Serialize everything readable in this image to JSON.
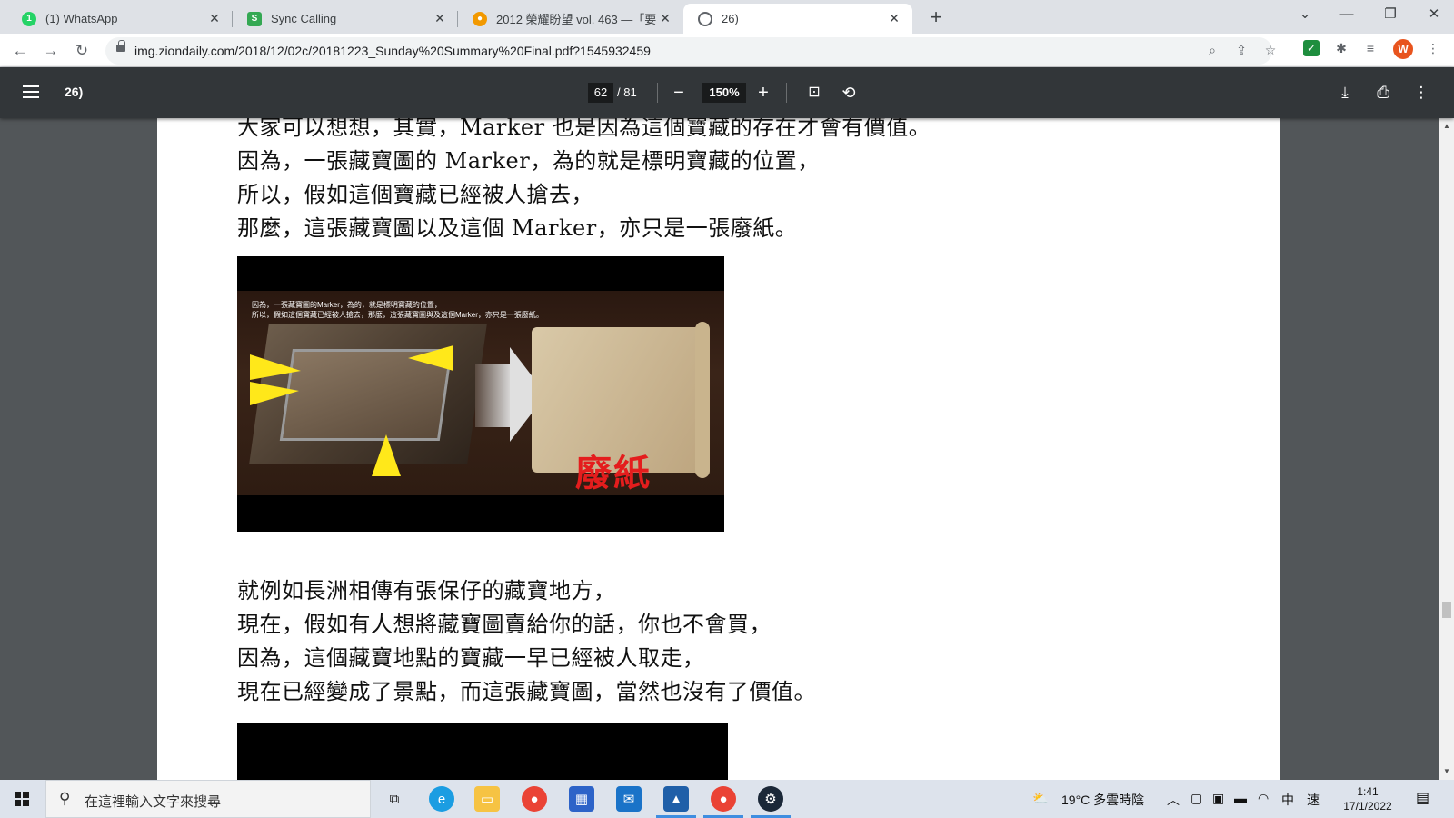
{
  "tabs": [
    {
      "title": "(1) WhatsApp",
      "favicon": "whatsapp-icon",
      "color": "#25d366"
    },
    {
      "title": "Sync Calling",
      "favicon": "sync-calling-icon",
      "color": "#34a853"
    },
    {
      "title": "2012 榮耀盼望 vol. 463 —「要",
      "favicon": "cookie-icon",
      "color": "#f29900"
    },
    {
      "title": "26)",
      "favicon": "globe-icon",
      "color": "#5f6368"
    }
  ],
  "address_bar": {
    "url": "img.ziondaily.com/2018/12/02c/20181223_Sunday%20Summary%20Final.pdf?1545932459",
    "avatar_letter": "W"
  },
  "pdf_toolbar": {
    "title": "26)",
    "current_page": "62",
    "total_pages": "/ 81",
    "zoom": "150%"
  },
  "document": {
    "para1": [
      "大家可以想想，其實，Marker 也是因為這個寶藏的存在才會有價值。",
      "因為，一張藏寶圖的 Marker，為的就是標明寶藏的位置，",
      "所以，假如這個寶藏已經被人搶去，",
      "那麼，這張藏寶圖以及這個 Marker，亦只是一張廢紙。"
    ],
    "image1_caption": [
      "因為，一張藏寶圖的Marker，為的，就是標明寶藏的位置，",
      "所以，假如這個寶藏已經被人搶去，那麼，這張藏寶圖與及這個Marker，亦只是一張廢紙。"
    ],
    "image1_stamp": "廢紙",
    "para2": [
      "就例如長洲相傳有張保仔的藏寶地方，",
      "現在，假如有人想將藏寶圖賣給你的話，你也不會買，",
      "因為，這個藏寶地點的寶藏一早已經被人取走，",
      "現在已經變成了景點，而這張藏寶圖，當然也沒有了價值。"
    ]
  },
  "taskbar": {
    "search_placeholder": "在這裡輸入文字來搜尋",
    "weather": "19°C 多雲時陰",
    "ime": "中",
    "ime2": "速",
    "time": "1:41",
    "date": "17/1/2022"
  },
  "colors": {
    "pdf_toolbar_bg": "#323639",
    "viewer_bg": "#525659",
    "tabstrip_bg": "#dee1e6",
    "waste_red": "#e41d1d"
  }
}
